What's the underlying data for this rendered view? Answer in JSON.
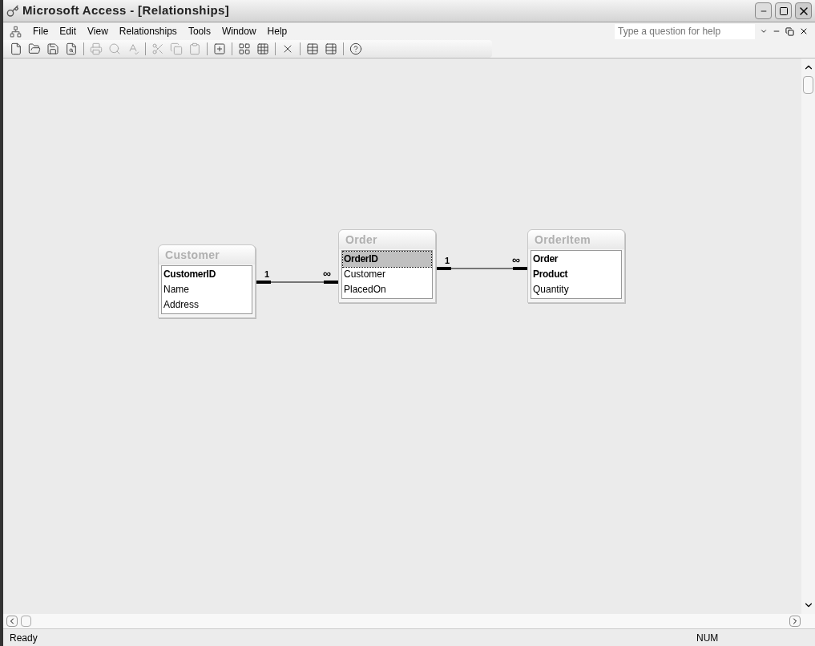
{
  "window": {
    "title": "Microsoft Access - [Relationships]"
  },
  "menu": [
    "File",
    "Edit",
    "View",
    "Relationships",
    "Tools",
    "Window",
    "Help"
  ],
  "help_box": {
    "placeholder": "Type a question for help"
  },
  "tables": [
    {
      "title": "Customer",
      "fields": [
        {
          "name": "CustomerID",
          "key": true,
          "selected": false
        },
        {
          "name": "Name",
          "key": false,
          "selected": false
        },
        {
          "name": "Address",
          "key": false,
          "selected": false
        }
      ]
    },
    {
      "title": "Order",
      "fields": [
        {
          "name": "OrderID",
          "key": true,
          "selected": true
        },
        {
          "name": "Customer",
          "key": false,
          "selected": false
        },
        {
          "name": "PlacedOn",
          "key": false,
          "selected": false
        }
      ]
    },
    {
      "title": "OrderItem",
      "fields": [
        {
          "name": "Order",
          "key": true,
          "selected": false
        },
        {
          "name": "Product",
          "key": true,
          "selected": false
        },
        {
          "name": "Quantity",
          "key": false,
          "selected": false
        }
      ]
    }
  ],
  "relationships": [
    {
      "one_label": "1",
      "many_label": "∞"
    },
    {
      "one_label": "1",
      "many_label": "∞"
    }
  ],
  "status_bar": {
    "message": "Ready",
    "indicator": "NUM"
  }
}
